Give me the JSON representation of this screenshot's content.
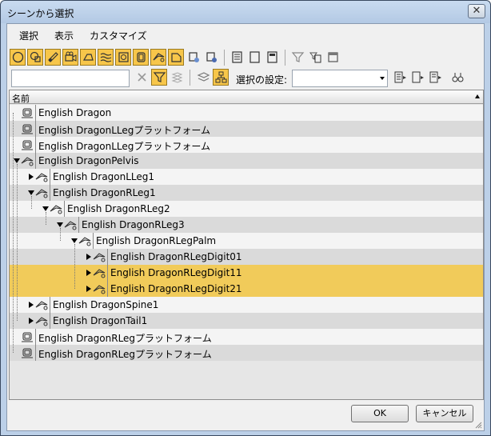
{
  "window": {
    "title": "シーンから選択",
    "close_glyph": "✕"
  },
  "menu": [
    "選択",
    "表示",
    "カスタマイズ"
  ],
  "toolbar": {
    "selection_set_label": "選択の設定:",
    "selection_set_value": "",
    "search_value": ""
  },
  "tree": {
    "column_header": "名前",
    "rows": [
      {
        "label": "English Dragon",
        "type": "platform",
        "depth": 0,
        "expander": "none",
        "selected": false
      },
      {
        "label": "English DragonLLegプラットフォーム",
        "type": "platform",
        "depth": 0,
        "expander": "none",
        "selected": false
      },
      {
        "label": "English DragonLLegプラットフォーム",
        "type": "platform",
        "depth": 0,
        "expander": "none",
        "selected": false
      },
      {
        "label": "English DragonPelvis",
        "type": "bone",
        "depth": 0,
        "expander": "expanded",
        "selected": false
      },
      {
        "label": "English DragonLLeg1",
        "type": "bone",
        "depth": 1,
        "expander": "collapsed",
        "selected": false
      },
      {
        "label": "English DragonRLeg1",
        "type": "bone",
        "depth": 1,
        "expander": "expanded",
        "selected": false
      },
      {
        "label": "English DragonRLeg2",
        "type": "bone",
        "depth": 2,
        "expander": "expanded",
        "selected": false
      },
      {
        "label": "English DragonRLeg3",
        "type": "bone",
        "depth": 3,
        "expander": "expanded",
        "selected": false
      },
      {
        "label": "English DragonRLegPalm",
        "type": "bone",
        "depth": 4,
        "expander": "expanded",
        "selected": false
      },
      {
        "label": "English DragonRLegDigit01",
        "type": "bone",
        "depth": 5,
        "expander": "collapsed",
        "selected": false
      },
      {
        "label": "English DragonRLegDigit11",
        "type": "bone",
        "depth": 5,
        "expander": "collapsed",
        "selected": true
      },
      {
        "label": "English DragonRLegDigit21",
        "type": "bone",
        "depth": 5,
        "expander": "collapsed",
        "selected": true
      },
      {
        "label": "English DragonSpine1",
        "type": "bone",
        "depth": 1,
        "expander": "collapsed",
        "selected": false
      },
      {
        "label": "English DragonTail1",
        "type": "bone",
        "depth": 1,
        "expander": "collapsed",
        "selected": false
      },
      {
        "label": "English DragonRLegプラットフォーム",
        "type": "platform",
        "depth": 0,
        "expander": "none",
        "selected": false
      },
      {
        "label": "English DragonRLegプラットフォーム",
        "type": "platform",
        "depth": 0,
        "expander": "none",
        "selected": false
      }
    ]
  },
  "buttons": {
    "ok": "OK",
    "cancel": "キャンセル"
  },
  "colors": {
    "selected_row": "#f1cb5a",
    "toggle_on": "#f7c64a"
  }
}
